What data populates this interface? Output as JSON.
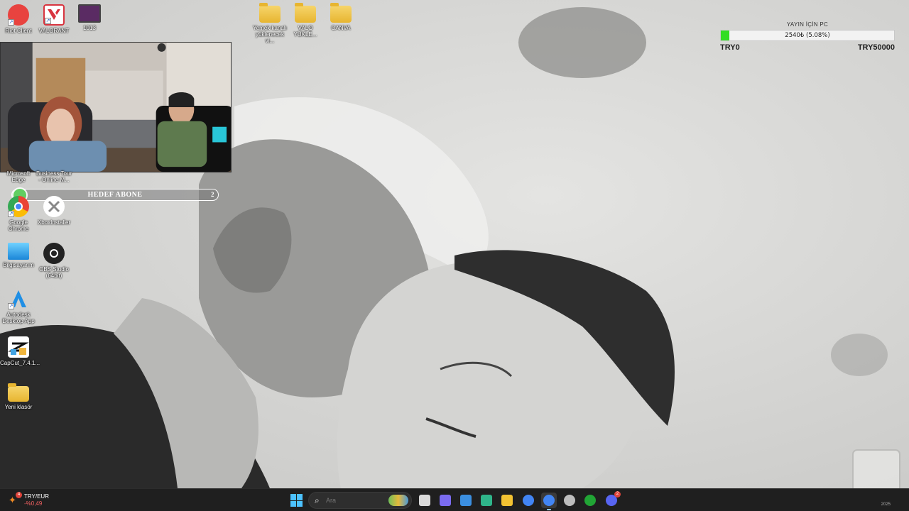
{
  "desktop": {
    "icons_top": [
      {
        "id": "riot",
        "label": "Riot Client",
        "icon": "riot-client-icon",
        "color": "#e8433f",
        "shortcut": true
      },
      {
        "id": "valorant",
        "label": "VALORANT",
        "icon": "valorant-icon",
        "color": "#d8343f",
        "shortcut": true
      },
      {
        "id": "video",
        "label": "1013",
        "icon": "video-thumbnail-icon",
        "color": "#5a2b63",
        "shortcut": false
      },
      {
        "id": "folder1",
        "label": "Yemek kanalı yüklenecek vi...",
        "icon": "folder-icon",
        "color": "#e7b530",
        "shortcut": false
      },
      {
        "id": "folder2",
        "label": "VALO YÜKLE...",
        "icon": "folder-icon",
        "color": "#e7b530",
        "shortcut": false
      },
      {
        "id": "folder3",
        "label": "CANVA",
        "icon": "folder-icon",
        "color": "#e7b530",
        "shortcut": false
      }
    ],
    "icons_left": [
      {
        "id": "edge",
        "label": "Microsoft Edge",
        "icon": "edge-icon"
      },
      {
        "id": "tour",
        "label": "Business Tour - Online M...",
        "icon": "game-icon"
      },
      {
        "id": "chrome",
        "label": "Google Chrome",
        "icon": "chrome-icon"
      },
      {
        "id": "xbox",
        "label": "XboxInstaller",
        "icon": "xbox-icon"
      },
      {
        "id": "bilgisayarim",
        "label": "Bilgisayarım",
        "icon": "monitor-icon"
      },
      {
        "id": "obs",
        "label": "OBS Studio (64bit)",
        "icon": "obs-icon"
      },
      {
        "id": "autodesk",
        "label": "Autodesk Desktop App",
        "icon": "autodesk-icon"
      },
      {
        "id": "capcut",
        "label": "CapCut_7.4.1...",
        "icon": "capcut-icon"
      },
      {
        "id": "yeni",
        "label": "Yeni klasör",
        "icon": "folder-icon"
      }
    ]
  },
  "goal": {
    "label": "HEDEF ABONE",
    "count": "2"
  },
  "donation": {
    "title": "YAYIN İÇİN PC",
    "progress_text": "2540₺ (5.08%)",
    "progress_fraction": 0.0508,
    "min_label": "TRY0",
    "max_label": "TRY50000",
    "fill_color": "#33dd22"
  },
  "taskbar": {
    "widget": {
      "title": "TRY/EUR",
      "value": "-%0,49",
      "badge": "4"
    },
    "search_placeholder": "Ara",
    "apps": [
      {
        "name": "task-view-icon",
        "color": "#d9d9d9",
        "badge": ""
      },
      {
        "name": "copilot-icon",
        "color": "#7b6cf0",
        "badge": ""
      },
      {
        "name": "store-icon",
        "color": "#3b8fe0",
        "badge": ""
      },
      {
        "name": "edge-icon",
        "color": "#2fb58a",
        "badge": ""
      },
      {
        "name": "file-explorer-icon",
        "color": "#f2c232",
        "badge": ""
      },
      {
        "name": "chrome-icon",
        "color": "#4285f4",
        "badge": ""
      },
      {
        "name": "chrome-profile-icon",
        "color": "#4285f4",
        "badge": ""
      },
      {
        "name": "riot-taskbar-icon",
        "color": "#bdbdbd",
        "badge": ""
      },
      {
        "name": "xbox-icon",
        "color": "#21a535",
        "badge": ""
      },
      {
        "name": "discord-icon",
        "color": "#5865f2",
        "badge": "2"
      }
    ],
    "tray_time": "2025"
  }
}
